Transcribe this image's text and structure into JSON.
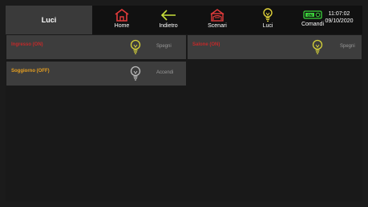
{
  "header": {
    "title": "Luci",
    "datetime_time": "11:07:02",
    "datetime_date": "09/10/2020"
  },
  "nav": [
    {
      "label": "Home",
      "icon": "home-icon",
      "color": "#e23b3b"
    },
    {
      "label": "Indietro",
      "icon": "back-arrow-icon",
      "color": "#c9e03a"
    },
    {
      "label": "Scenari",
      "icon": "scenarios-icon",
      "color": "#e23b3b"
    },
    {
      "label": "Luci",
      "icon": "bulb-icon",
      "color": "#e0d23a"
    },
    {
      "label": "Comandi",
      "icon": "switch-icon",
      "color": "#3bd23b",
      "badge": "ON"
    }
  ],
  "lights": [
    {
      "name": "Ingresso (ON)",
      "state": "on",
      "action": "Spegni",
      "label_color": "#c22a2a"
    },
    {
      "name": "Salone (ON)",
      "state": "on",
      "action": "Spegni",
      "label_color": "#c22a2a"
    },
    {
      "name": "Soggiorno (OFF)",
      "state": "off",
      "action": "Accendi",
      "label_color": "#e8a020"
    }
  ],
  "colors": {
    "bulb_on": "#d6d23a",
    "bulb_off": "#bdbdbd"
  }
}
